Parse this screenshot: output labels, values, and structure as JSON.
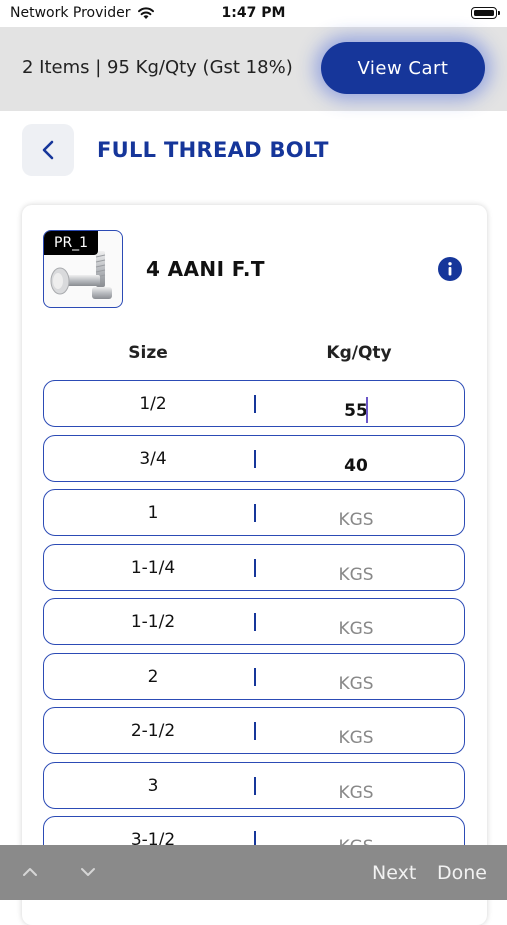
{
  "status_bar": {
    "carrier": "Network Provider",
    "time": "1:47 PM"
  },
  "cart_bar": {
    "summary": "2 Items | 95 Kg/Qty (Gst 18%)",
    "view_cart_label": "View Cart"
  },
  "header": {
    "title": "FULL THREAD BOLT"
  },
  "product": {
    "code": "PR_1",
    "name": "4 AANI F.T",
    "columns": {
      "size": "Size",
      "kg_qty": "Kg/Qty"
    },
    "rows": [
      {
        "size": "1/2",
        "value": "55",
        "placeholder": "KGS"
      },
      {
        "size": "3/4",
        "value": "40",
        "placeholder": "KGS"
      },
      {
        "size": "1",
        "value": "",
        "placeholder": "KGS"
      },
      {
        "size": "1-1/4",
        "value": "",
        "placeholder": "KGS"
      },
      {
        "size": "1-1/2",
        "value": "",
        "placeholder": "KGS"
      },
      {
        "size": "2",
        "value": "",
        "placeholder": "KGS"
      },
      {
        "size": "2-1/2",
        "value": "",
        "placeholder": "KGS"
      },
      {
        "size": "3",
        "value": "",
        "placeholder": "KGS"
      },
      {
        "size": "3-1/2",
        "value": "",
        "placeholder": "KGS"
      }
    ]
  },
  "accessory_bar": {
    "next_label": "Next",
    "done_label": "Done"
  },
  "colors": {
    "accent": "#16369a",
    "cart_bar_bg": "#e3e3e3",
    "accessory_bg": "#8a8a8a"
  },
  "icons": [
    "wifi-icon",
    "battery-icon",
    "back-chevron-icon",
    "info-icon",
    "chevron-up-icon",
    "chevron-down-icon"
  ]
}
